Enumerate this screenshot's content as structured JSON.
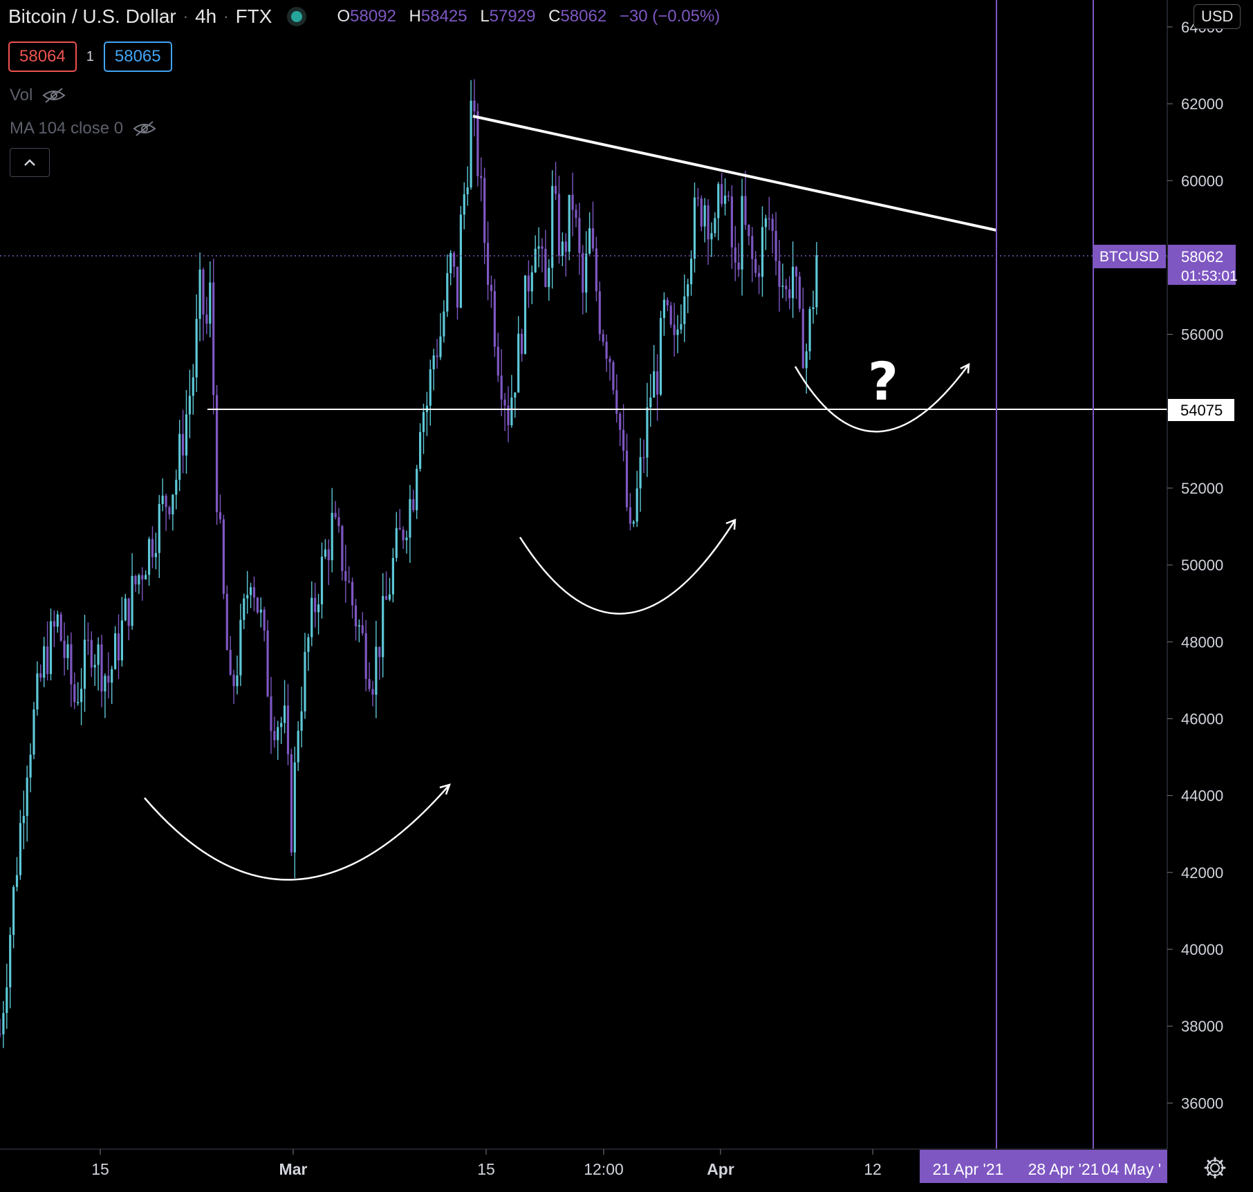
{
  "header": {
    "symbol": "Bitcoin / U.S. Dollar",
    "interval": "4h",
    "exchange": "FTX",
    "open_label": "O",
    "open": "58092",
    "high_label": "H",
    "high": "58425",
    "low_label": "L",
    "low": "57929",
    "close_label": "C",
    "close": "58062",
    "change": "−30 (−0.05%)"
  },
  "quote": {
    "bid": "58064",
    "spread": "1",
    "ask": "58065"
  },
  "indicators": [
    {
      "label": "Vol",
      "icon": "eye-hidden-icon"
    },
    {
      "label": "MA 104 close 0",
      "icon": "eye-hidden-icon"
    }
  ],
  "currency_button": "USD",
  "colors": {
    "background": "#000000",
    "candle_up": "#5ec8d8",
    "candle_down": "#7e57c2",
    "accent": "#7e57c2",
    "drawing": "#ffffff"
  },
  "chart_data": {
    "type": "candlestick",
    "title": "Bitcoin / U.S. Dollar · 4h · FTX",
    "ylim": [
      34800,
      64700
    ],
    "grid": false,
    "y_ticks": [
      "36000",
      "38000",
      "40000",
      "42000",
      "44000",
      "46000",
      "48000",
      "50000",
      "52000",
      "54000",
      "56000",
      "58000",
      "60000",
      "62000",
      "64000"
    ],
    "x_ticks": [
      "15",
      "Mar",
      "15",
      "12:00",
      "Apr",
      "12"
    ],
    "x_future_labels": [
      "21 Apr '21",
      "28 Apr '21",
      "04 May '"
    ],
    "last_price": {
      "symbol": "BTCUSD",
      "price": "58062",
      "countdown": "01:53:01"
    },
    "horizontal_level": "54075",
    "price_path": [
      [
        0,
        37800
      ],
      [
        8,
        45000
      ],
      [
        13,
        47500
      ],
      [
        17,
        48500
      ],
      [
        22,
        46500
      ],
      [
        27,
        48000
      ],
      [
        32,
        47000
      ],
      [
        38,
        49000
      ],
      [
        44,
        50500
      ],
      [
        48,
        51500
      ],
      [
        52,
        52300
      ],
      [
        57,
        55000
      ],
      [
        59,
        57000
      ],
      [
        61,
        56200
      ],
      [
        62,
        57000
      ],
      [
        63,
        54500
      ],
      [
        64,
        52000
      ],
      [
        66,
        49000
      ],
      [
        68,
        46500
      ],
      [
        71,
        48000
      ],
      [
        74,
        50000
      ],
      [
        77,
        48500
      ],
      [
        80,
        46200
      ],
      [
        84,
        45800
      ],
      [
        86,
        43100
      ],
      [
        88,
        46000
      ],
      [
        91,
        48000
      ],
      [
        94,
        49500
      ],
      [
        98,
        51000
      ],
      [
        101,
        50200
      ],
      [
        104,
        49000
      ],
      [
        107,
        48000
      ],
      [
        110,
        47200
      ],
      [
        113,
        48500
      ],
      [
        116,
        50000
      ],
      [
        119,
        51000
      ],
      [
        122,
        52000
      ],
      [
        124,
        54000
      ],
      [
        126,
        54200
      ],
      [
        128,
        55500
      ],
      [
        130,
        56000
      ],
      [
        133,
        57800
      ],
      [
        135,
        57000
      ],
      [
        136,
        58800
      ],
      [
        138,
        60500
      ],
      [
        139,
        61800
      ],
      [
        141,
        60500
      ],
      [
        143,
        58500
      ],
      [
        145,
        57000
      ],
      [
        147,
        55500
      ],
      [
        150,
        54000
      ],
      [
        153,
        55500
      ],
      [
        156,
        57500
      ],
      [
        158,
        58800
      ],
      [
        161,
        57000
      ],
      [
        163,
        59500
      ],
      [
        166,
        58000
      ],
      [
        169,
        59500
      ],
      [
        172,
        57000
      ],
      [
        174,
        58500
      ],
      [
        177,
        56500
      ],
      [
        180,
        55500
      ],
      [
        182,
        54500
      ],
      [
        184,
        52500
      ],
      [
        186,
        50500
      ],
      [
        188,
        51800
      ],
      [
        190,
        53000
      ],
      [
        192,
        54500
      ],
      [
        194,
        55000
      ],
      [
        196,
        56500
      ],
      [
        199,
        55500
      ],
      [
        202,
        57500
      ],
      [
        205,
        59000
      ],
      [
        208,
        59500
      ],
      [
        211,
        58500
      ],
      [
        213,
        60000
      ],
      [
        215,
        59000
      ],
      [
        217,
        57500
      ],
      [
        219,
        59000
      ],
      [
        221,
        58200
      ],
      [
        223,
        57500
      ],
      [
        225,
        58500
      ],
      [
        227,
        59000
      ],
      [
        229,
        58200
      ],
      [
        232,
        57000
      ],
      [
        234,
        57800
      ],
      [
        236,
        56000
      ],
      [
        238,
        55600
      ],
      [
        240,
        57000
      ],
      [
        241,
        58062
      ]
    ],
    "bottoms": [
      {
        "date_index": 86,
        "price": 43100
      },
      {
        "date_index": 186,
        "price": 50500
      },
      {
        "date_index": 238,
        "price": 55600
      }
    ],
    "trendline": [
      {
        "date_index": 139,
        "price": 61700
      },
      {
        "date_index": 291,
        "price": 58700
      }
    ],
    "vertical_markers": [
      "21 Apr '21",
      "28 Apr '21"
    ],
    "annotation": "?"
  }
}
